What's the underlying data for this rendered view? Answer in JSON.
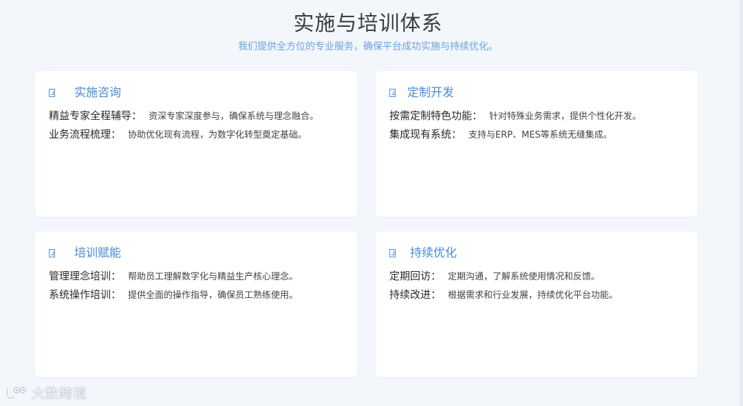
{
  "header": {
    "title": "实施与培训体系",
    "subtitle": "我们提供全方位的专业服务，确保平台成功实施与持续优化。"
  },
  "cards": [
    {
      "title": "实施咨询",
      "icon": "missing-glyph-icon",
      "items": [
        {
          "key": "精益专家全程辅导：",
          "value": "资深专家深度参与，确保系统与理念融合。"
        },
        {
          "key": "业务流程梳理：",
          "value": "协助优化现有流程，为数字化转型奠定基础。"
        }
      ]
    },
    {
      "title": "定制开发",
      "icon": "missing-glyph-icon",
      "items": [
        {
          "key": "按需定制特色功能：",
          "value": "针对特殊业务需求，提供个性化开发。"
        },
        {
          "key": "集成现有系统：",
          "value": "支持与ERP、MES等系统无缝集成。"
        }
      ]
    },
    {
      "title": "培训赋能",
      "icon": "missing-glyph-icon",
      "items": [
        {
          "key": "管理理念培训：",
          "value": "帮助员工理解数字化与精益生产核心理念。"
        },
        {
          "key": "系统操作培训：",
          "value": "提供全面的操作指导，确保员工熟练使用。"
        }
      ]
    },
    {
      "title": "持续优化",
      "icon": "missing-glyph-icon",
      "items": [
        {
          "key": "定期回访：",
          "value": "定期沟通，了解系统使用情况和反馈。"
        },
        {
          "key": "持续改进：",
          "value": "根据需求和行业发展，持续优化平台功能。"
        }
      ]
    }
  ],
  "watermark": {
    "text": "大数跨境"
  },
  "colors": {
    "accent": "#4a8ad6",
    "subtitle": "#6ca3dc",
    "background": "#f3f6fb",
    "card": "#ffffff"
  }
}
